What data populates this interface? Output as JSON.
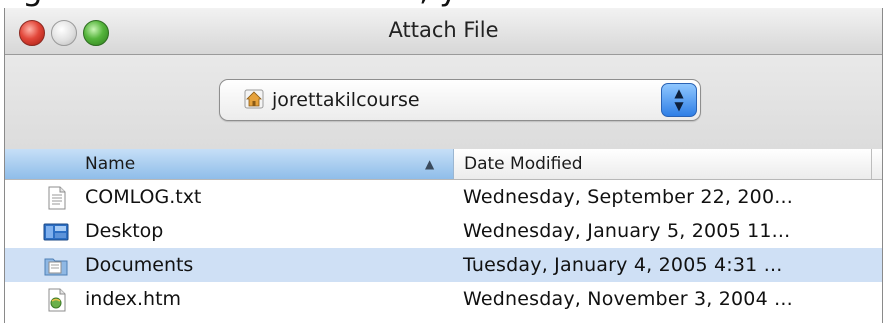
{
  "top_fragment": "ng ............................... ...., y ................................",
  "window": {
    "title": "Attach File",
    "path_selector": {
      "value": "jorettakilcourse",
      "icon": "home-icon"
    }
  },
  "columns": [
    {
      "label": "Name",
      "sorted": true,
      "sort_indicator": "▲"
    },
    {
      "label": "Date Modified"
    }
  ],
  "files": [
    {
      "name": "COMLOG.txt",
      "date": "Wednesday, September 22, 200...",
      "icon": "text-file-icon",
      "selected": false
    },
    {
      "name": "Desktop",
      "date": "Wednesday, January 5, 2005 11...",
      "icon": "desktop-folder-icon",
      "selected": false
    },
    {
      "name": "Documents",
      "date": "Tuesday, January 4, 2005 4:31 ...",
      "icon": "documents-folder-icon",
      "selected": true
    },
    {
      "name": "index.htm",
      "date": "Wednesday, November 3, 2004 ...",
      "icon": "html-file-icon",
      "selected": false
    }
  ]
}
